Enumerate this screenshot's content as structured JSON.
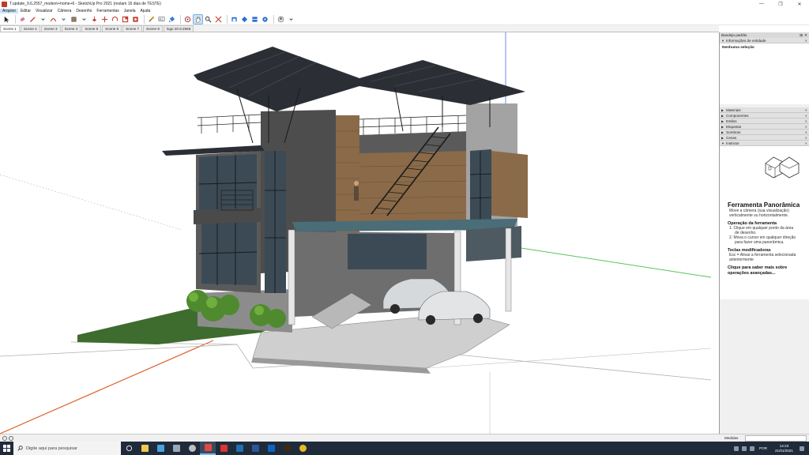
{
  "window": {
    "title": "T.update_9.6.2557_modern+home+6 - SketchUp Pro 2021 (restam 16 dias de TESTE)",
    "controls": [
      "—",
      "❐",
      "✕"
    ]
  },
  "menubar": [
    "Arquivo",
    "Editar",
    "Visualizar",
    "Câmera",
    "Desenho",
    "Ferramentas",
    "Janela",
    "Ajuda"
  ],
  "toolbar": {
    "tools": [
      "select-tool",
      "eraser-tool",
      "pencil-tool",
      "arc-tool",
      "shape-tool",
      "push-pull-tool",
      "move-tool",
      "rotate-tool",
      "scale-tool",
      "offset-tool",
      "tape-measure-tool",
      "text-tool",
      "paint-bucket-tool",
      "orbit-tool",
      "pan-tool",
      "zoom-tool",
      "zoom-extents-tool",
      "warehouse-tool",
      "extension-warehouse-tool",
      "layout-tool",
      "extension-manager-tool",
      "dropdown"
    ]
  },
  "scenes": {
    "tabs": [
      "Scene 1",
      "Scene 2",
      "Scene 3",
      "Scene 4",
      "Scene 5",
      "Scene 6",
      "Scene 7",
      "Scene 8",
      "logo 20.9.2556"
    ],
    "active_index": 0
  },
  "tray": {
    "title": "Bandeja padrão",
    "entity_info": {
      "header": "Informações de entidade",
      "body": "Nenhuma seleção"
    },
    "panels": [
      "Materiais",
      "Componentes",
      "Estilos",
      "Etiquetas",
      "Sombras",
      "Cenas",
      "Instrutor"
    ],
    "instructor": {
      "title": "Ferramenta Panorâmica",
      "intro_1": "Move a câmera (sua visualização)",
      "intro_2": "verticalmente ou horizontalmente.",
      "op_heading": "Operação da ferramenta",
      "op_1a": "1. Clique em qualquer ponto da área",
      "op_1b": "de desenho.",
      "op_2a": "2. Mova o cursor em qualquer direção",
      "op_2b": "para fazer uma panorâmica.",
      "keys_heading": "Teclas modificadoras",
      "keys_1": "Esc = Ativar a ferramenta selecionada",
      "keys_2": "anteriormente",
      "more_1": "Clique para saber mais sobre",
      "more_2": "operações avançadas..."
    }
  },
  "statusbar": {
    "measure_label": "Medidas",
    "measure_value": ""
  },
  "taskbar": {
    "search_placeholder": "Digite aqui para pesquisar",
    "apps": [
      {
        "name": "task-view",
        "color": "#ffffff"
      },
      {
        "name": "file-explorer",
        "color": "#f2c94c"
      },
      {
        "name": "store",
        "color": "#4aa3df"
      },
      {
        "name": "photos",
        "color": "#9aa7b5"
      },
      {
        "name": "settings",
        "color": "#bfbfbf"
      },
      {
        "name": "sketchup",
        "color": "#e04a3f"
      },
      {
        "name": "vray",
        "color": "#d33"
      },
      {
        "name": "revit",
        "color": "#1f6fb5"
      },
      {
        "name": "word",
        "color": "#2b579a"
      },
      {
        "name": "photoshop",
        "color": "#0c64c5"
      },
      {
        "name": "illustrator",
        "color": "#3a2a1a"
      },
      {
        "name": "chrome",
        "color": "#e8b923"
      }
    ],
    "active_app": 5,
    "lang": "POR",
    "time": "14:23",
    "date": "21/01/2021"
  },
  "colors": {
    "accent": "#cce4f7",
    "taskbar": "#1f2b3a",
    "lawn": "#3e6b2e",
    "axis_red": "#e0602a",
    "axis_green": "#5cc35c",
    "axis_blue": "#6a8cf0"
  }
}
